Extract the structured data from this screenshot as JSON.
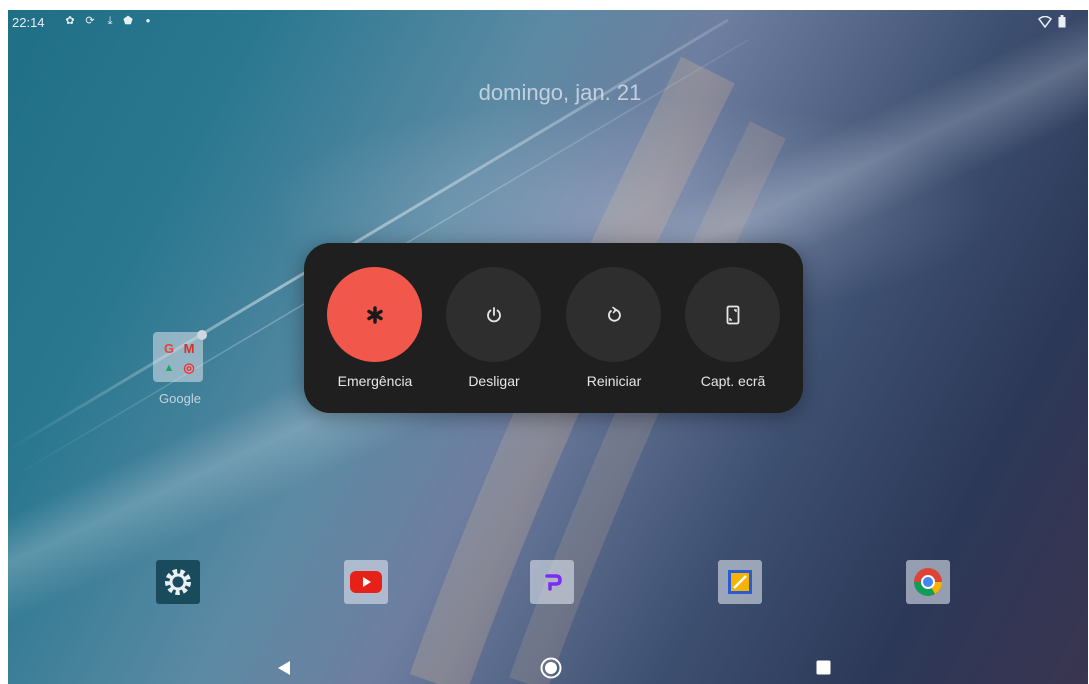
{
  "status_bar": {
    "time": "22:14",
    "left_icons": [
      "settings-icon",
      "sync-icon",
      "download-icon",
      "shield-play-icon",
      "dot-icon"
    ],
    "right_icons": [
      "wifi-icon",
      "battery-icon"
    ]
  },
  "lockscreen": {
    "date": "domingo, jan. 21"
  },
  "home": {
    "folder": {
      "label": "Google",
      "apps": [
        "G",
        "M",
        "▲",
        "◎"
      ]
    },
    "dock": [
      "Settings",
      "YouTube",
      "Pocket",
      "Files",
      "Chrome"
    ]
  },
  "power_menu": {
    "buttons": [
      {
        "label": "Emergência",
        "icon": "emergency-asterisk-icon",
        "color": "#f2574b"
      },
      {
        "label": "Desligar",
        "icon": "power-icon",
        "color": "#2e2e2e"
      },
      {
        "label": "Reiniciar",
        "icon": "restart-icon",
        "color": "#2e2e2e"
      },
      {
        "label": "Capt. ecrã",
        "icon": "screenshot-icon",
        "color": "#2e2e2e"
      }
    ]
  },
  "nav_bar": {
    "buttons": [
      "back-icon",
      "home-icon",
      "recents-icon"
    ]
  }
}
